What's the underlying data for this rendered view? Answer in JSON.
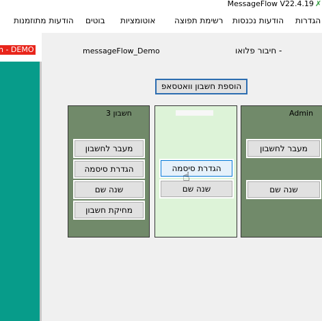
{
  "window": {
    "title": "MessageFlow V22.4.19"
  },
  "menu": {
    "items": [
      "הגדרות",
      "הודעות נכנסות",
      "רשימת תפוצה",
      "אוטומציות",
      "בוטים",
      "הודעות מתוזמנות"
    ]
  },
  "left": {
    "badge": "n - DEMO"
  },
  "header": {
    "account_name": "messageFlow_Demo",
    "connection_label": "חיבור פלואו -"
  },
  "add_account_button": "הוספת חשבון וואטסאפ",
  "columns": [
    {
      "title": "חשבון 3",
      "buttons": [
        "מעבר לחשבון",
        "הגדרת סיסמה",
        "שנה שם",
        "מחיקת חשבון"
      ]
    },
    {
      "title": "",
      "buttons": [
        "הגדרת סיסמה",
        "שנה שם"
      ]
    },
    {
      "title": "Admin",
      "buttons": [
        "מעבר לחשבון",
        "שנה שם"
      ]
    }
  ],
  "colors": {
    "column_dark": "#718a6a",
    "column_light": "#ddf3d8",
    "teal": "#079c8a",
    "demo_red": "#e8251b",
    "accent_border": "#2b6cb0"
  }
}
